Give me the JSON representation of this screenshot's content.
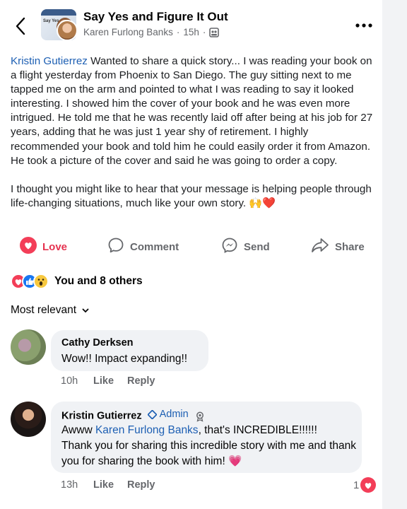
{
  "header": {
    "title": "Say Yes and Figure It Out",
    "author": "Karen Furlong Banks",
    "time": "15h",
    "thumb_text": "Say Yes"
  },
  "post": {
    "mention": "Kristin Gutierrez",
    "paragraph1": " Wanted to share a quick story... I was reading your book on a flight yesterday from Phoenix to San Diego. The guy sitting next to me tapped me on the arm and pointed to what I was reading to say it looked interesting. I showed him the cover of your book and he was even more intrigued. He told me that he was recently laid off after being at his job for 27 years, adding that he was just 1 year shy of retirement. I highly recommended your book and told him he could easily order it from Amazon. He took a picture of the cover and said he was going to order a copy.",
    "paragraph2": "I thought you might like to hear that your message is helping people through life-changing situations, much like your own story. 🙌❤️"
  },
  "actions": {
    "love": "Love",
    "comment": "Comment",
    "send": "Send",
    "share": "Share"
  },
  "reactions": {
    "summary": "You and 8 others"
  },
  "sort": {
    "label": "Most relevant"
  },
  "comments": [
    {
      "name": "Cathy Derksen",
      "text": "Wow!! Impact expanding!!",
      "time": "10h",
      "like": "Like",
      "reply": "Reply"
    },
    {
      "name": "Kristin Gutierrez",
      "badge": "Admin",
      "mention": "Karen Furlong Banks",
      "text_prefix": "Awww ",
      "text_suffix": ", that's INCREDIBLE!!!!!!",
      "text_rest": "Thank you for sharing this incredible story with me and thank you for sharing the book with him! 💗",
      "time": "13h",
      "like": "Like",
      "reply": "Reply",
      "love_count": "1"
    }
  ],
  "colors": {
    "accent": "#1d5fb3",
    "love": "#e5324f",
    "muted": "#65676b"
  }
}
